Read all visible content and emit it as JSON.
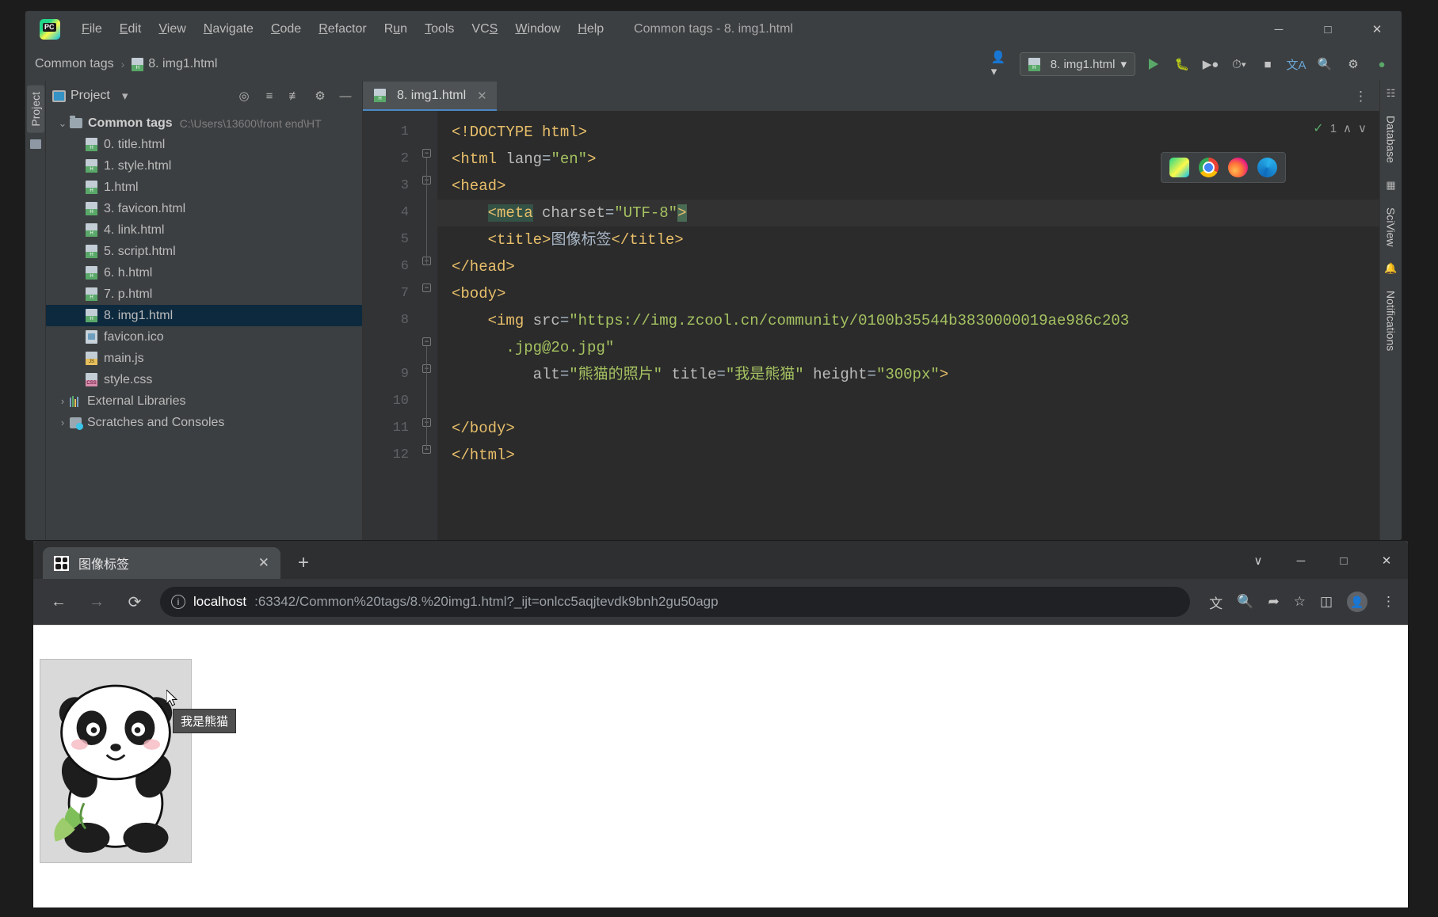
{
  "ide": {
    "window_title": "Common tags - 8. img1.html",
    "logo": "pycharm-logo",
    "menu": [
      {
        "label": "File",
        "mnemonic": "F"
      },
      {
        "label": "Edit",
        "mnemonic": "E"
      },
      {
        "label": "View",
        "mnemonic": "V"
      },
      {
        "label": "Navigate",
        "mnemonic": "N"
      },
      {
        "label": "Code",
        "mnemonic": "C"
      },
      {
        "label": "Refactor",
        "mnemonic": "R"
      },
      {
        "label": "Run",
        "mnemonic": "u"
      },
      {
        "label": "Tools",
        "mnemonic": "T"
      },
      {
        "label": "VCS",
        "mnemonic": "S"
      },
      {
        "label": "Window",
        "mnemonic": "W"
      },
      {
        "label": "Help",
        "mnemonic": "H"
      }
    ],
    "window_buttons": {
      "minimize": "─",
      "maximize": "□",
      "close": "✕"
    },
    "breadcrumb": {
      "project": "Common tags",
      "file": "8. img1.html",
      "separator": "›"
    },
    "toolbar": {
      "run_config": "8. img1.html",
      "run_config_caret": "▾",
      "run": "run-button",
      "debug": "debug-button",
      "coverage": "run-with-coverage-button",
      "profile": "profile-button",
      "stop": "stop-button",
      "translate": "translate-button",
      "search": "search-everywhere-button",
      "settings": "settings-button",
      "updates": "updates-button",
      "user": "user-account-button"
    },
    "project_panel": {
      "title": "Project",
      "caret": "▾",
      "actions": [
        "locate-icon",
        "expand-all-icon",
        "collapse-all-icon",
        "settings-icon",
        "hide-icon"
      ],
      "vertical_tab": "Project",
      "tree": [
        {
          "label": "Common tags",
          "path": "C:\\Users\\13600\\front end\\HT",
          "type": "folder",
          "expanded": true,
          "indent": 0,
          "selected": false
        },
        {
          "label": "0. title.html",
          "type": "html",
          "indent": 1,
          "selected": false
        },
        {
          "label": "1. style.html",
          "type": "html",
          "indent": 1,
          "selected": false
        },
        {
          "label": "1.html",
          "type": "html",
          "indent": 1,
          "selected": false
        },
        {
          "label": "3. favicon.html",
          "type": "html",
          "indent": 1,
          "selected": false
        },
        {
          "label": "4. link.html",
          "type": "html",
          "indent": 1,
          "selected": false
        },
        {
          "label": "5. script.html",
          "type": "html",
          "indent": 1,
          "selected": false
        },
        {
          "label": "6. h.html",
          "type": "html",
          "indent": 1,
          "selected": false
        },
        {
          "label": "7. p.html",
          "type": "html",
          "indent": 1,
          "selected": false
        },
        {
          "label": "8. img1.html",
          "type": "html",
          "indent": 1,
          "selected": true
        },
        {
          "label": "favicon.ico",
          "type": "ico",
          "indent": 1,
          "selected": false
        },
        {
          "label": "main.js",
          "type": "js",
          "indent": 1,
          "selected": false
        },
        {
          "label": "style.css",
          "type": "css",
          "indent": 1,
          "selected": false
        },
        {
          "label": "External Libraries",
          "type": "libs",
          "indent": 0,
          "expanded": false,
          "selected": false
        },
        {
          "label": "Scratches and Consoles",
          "type": "scratches",
          "indent": 0,
          "expanded": false,
          "selected": false
        }
      ]
    },
    "editor": {
      "tab": {
        "label": "8. img1.html",
        "close": "✕"
      },
      "kebab": "⋮",
      "inspection_count": "1",
      "inspection_check": "✓",
      "inspection_up": "∧",
      "inspection_down": "∨",
      "browser_popup": [
        "pycharm-icon",
        "chrome-icon",
        "firefox-icon",
        "edge-icon"
      ],
      "line_numbers": [
        "1",
        "2",
        "3",
        "4",
        "5",
        "6",
        "7",
        "8",
        "9",
        "10",
        "11",
        "12"
      ],
      "lines": [
        {
          "n": "1",
          "segments": [
            {
              "t": "<!DOCTYPE html>",
              "c": "tag"
            }
          ]
        },
        {
          "n": "2",
          "segments": [
            {
              "t": "<html ",
              "c": "tag"
            },
            {
              "t": "lang",
              "c": "attr"
            },
            {
              "t": "=",
              "c": "punc"
            },
            {
              "t": "\"en\"",
              "c": "str"
            },
            {
              "t": ">",
              "c": "tag"
            }
          ]
        },
        {
          "n": "3",
          "segments": [
            {
              "t": "<head>",
              "c": "tag"
            }
          ]
        },
        {
          "n": "4",
          "segments": [
            {
              "t": "    ",
              "c": "punc"
            },
            {
              "t": "<meta",
              "c": "sel-tag"
            },
            {
              "t": " ",
              "c": "punc"
            },
            {
              "t": "charset",
              "c": "attr"
            },
            {
              "t": "=",
              "c": "punc"
            },
            {
              "t": "\"UTF-8\"",
              "c": "str"
            },
            {
              "t": ">",
              "c": "sel-gt"
            }
          ]
        },
        {
          "n": "5",
          "segments": [
            {
              "t": "    ",
              "c": "punc"
            },
            {
              "t": "<title>",
              "c": "tag"
            },
            {
              "t": "图像标签",
              "c": "txt"
            },
            {
              "t": "</title>",
              "c": "tag"
            }
          ]
        },
        {
          "n": "6",
          "segments": [
            {
              "t": "</head>",
              "c": "tag"
            }
          ]
        },
        {
          "n": "7",
          "segments": [
            {
              "t": "<body>",
              "c": "tag"
            }
          ]
        },
        {
          "n": "8",
          "segments": [
            {
              "t": "    ",
              "c": "punc"
            },
            {
              "t": "<img ",
              "c": "tag"
            },
            {
              "t": "src",
              "c": "attr"
            },
            {
              "t": "=",
              "c": "punc"
            },
            {
              "t": "\"https://img.zcool.cn/community/0100b35544b3830000019ae986c203",
              "c": "str"
            }
          ]
        },
        {
          "n": "",
          "segments": [
            {
              "t": "      ",
              "c": "punc"
            },
            {
              "t": ".jpg@2o.jpg\"",
              "c": "str"
            }
          ]
        },
        {
          "n": "9",
          "segments": [
            {
              "t": "         ",
              "c": "punc"
            },
            {
              "t": "alt",
              "c": "attr"
            },
            {
              "t": "=",
              "c": "punc"
            },
            {
              "t": "\"熊猫的照片\"",
              "c": "str"
            },
            {
              "t": " ",
              "c": "punc"
            },
            {
              "t": "title",
              "c": "attr"
            },
            {
              "t": "=",
              "c": "punc"
            },
            {
              "t": "\"我是熊猫\"",
              "c": "str"
            },
            {
              "t": " ",
              "c": "punc"
            },
            {
              "t": "height",
              "c": "attr"
            },
            {
              "t": "=",
              "c": "punc"
            },
            {
              "t": "\"300px\"",
              "c": "str"
            },
            {
              "t": ">",
              "c": "tag"
            }
          ]
        },
        {
          "n": "10",
          "segments": []
        },
        {
          "n": "11",
          "segments": [
            {
              "t": "</body>",
              "c": "tag"
            }
          ]
        },
        {
          "n": "12",
          "segments": [
            {
              "t": "</html>",
              "c": "tag"
            }
          ]
        }
      ]
    },
    "right_strip": [
      "Database",
      "SciView",
      "Notifications"
    ]
  },
  "browser": {
    "tab": {
      "title": "图像标签",
      "close": "✕"
    },
    "new_tab": "+",
    "window_buttons": {
      "chevron": "∨",
      "minimize": "─",
      "maximize": "□",
      "close": "✕"
    },
    "nav": {
      "back": "←",
      "forward": "→",
      "reload": "⟳"
    },
    "omnibox": {
      "info_icon": "ⓘ",
      "host": "localhost",
      "rest": ":63342/Common%20tags/8.%20img1.html?_ijt=onlcc5aqjtevdk9bnh2gu50agp",
      "full_url": "localhost:63342/Common%20tags/8.%20img1.html?_ijt=onlcc5aqjtevdk9bnh2gu50agp"
    },
    "omni_actions": [
      "translate-icon",
      "zoom-icon",
      "share-icon",
      "bookmark-star-icon",
      "side-panel-icon",
      "profile-avatar-icon",
      "chrome-menu-icon"
    ],
    "page": {
      "image_alt": "熊猫的照片",
      "tooltip": "我是熊猫"
    }
  },
  "colors": {
    "ide_chrome": "#3c3f41",
    "editor_bg": "#2b2b2b",
    "gutter_bg": "#313335",
    "selection": "#0d293e",
    "accent_blue": "#4a88c7",
    "string_green": "#a5c261",
    "tag_orange": "#e8bf6a",
    "browser_chrome": "#35373a",
    "page_bg": "#ffffff",
    "tooltip_bg": "#4f4f4f"
  }
}
